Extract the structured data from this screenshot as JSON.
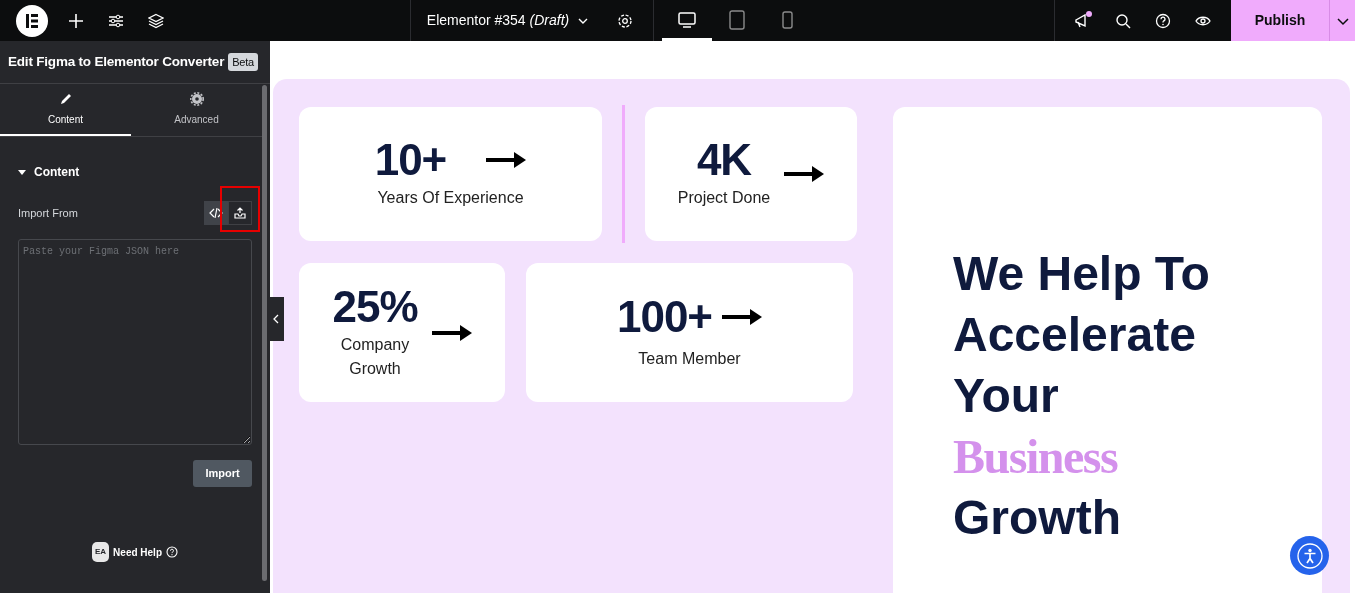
{
  "topbar": {
    "document_title": "Elementor #354",
    "document_status": "(Draft)",
    "devices": [
      {
        "kind": "desktop",
        "selected": true
      },
      {
        "kind": "tablet",
        "selected": false
      },
      {
        "kind": "mobile",
        "selected": false
      }
    ],
    "notification": true,
    "publish": "Publish"
  },
  "panel": {
    "title": "Edit Figma to Elementor Converter",
    "badge": "Beta",
    "tabs": [
      {
        "label": "Content",
        "kind": "pencil",
        "selected": true
      },
      {
        "label": "Advanced",
        "kind": "gear",
        "selected": false
      }
    ],
    "section": {
      "title": "Content",
      "expanded": true
    },
    "import_label": "Import From",
    "import_sources": [
      {
        "kind": "code",
        "selected": true,
        "highlighted": false
      },
      {
        "kind": "upload",
        "selected": false,
        "highlighted": true
      }
    ],
    "json_field": {
      "placeholder": "Paste your Figma JSON here"
    },
    "import_button": "Import",
    "help": {
      "logo": "EA",
      "label": "Need Help"
    }
  },
  "stats": [
    {
      "value": "10+",
      "label": "Years Of Experience"
    },
    {
      "value": "4K",
      "label": "Project Done"
    },
    {
      "value": "25%",
      "label": "Company Growth"
    },
    {
      "value": "100+",
      "label": "Team Member"
    }
  ],
  "hero": [
    {
      "text": "We Help To",
      "accent": false
    },
    {
      "text": "Accelerate",
      "accent": false
    },
    {
      "text": "Your",
      "accent": false
    },
    {
      "text": "Business",
      "accent": true
    },
    {
      "text": "Growth",
      "accent": false
    }
  ]
}
